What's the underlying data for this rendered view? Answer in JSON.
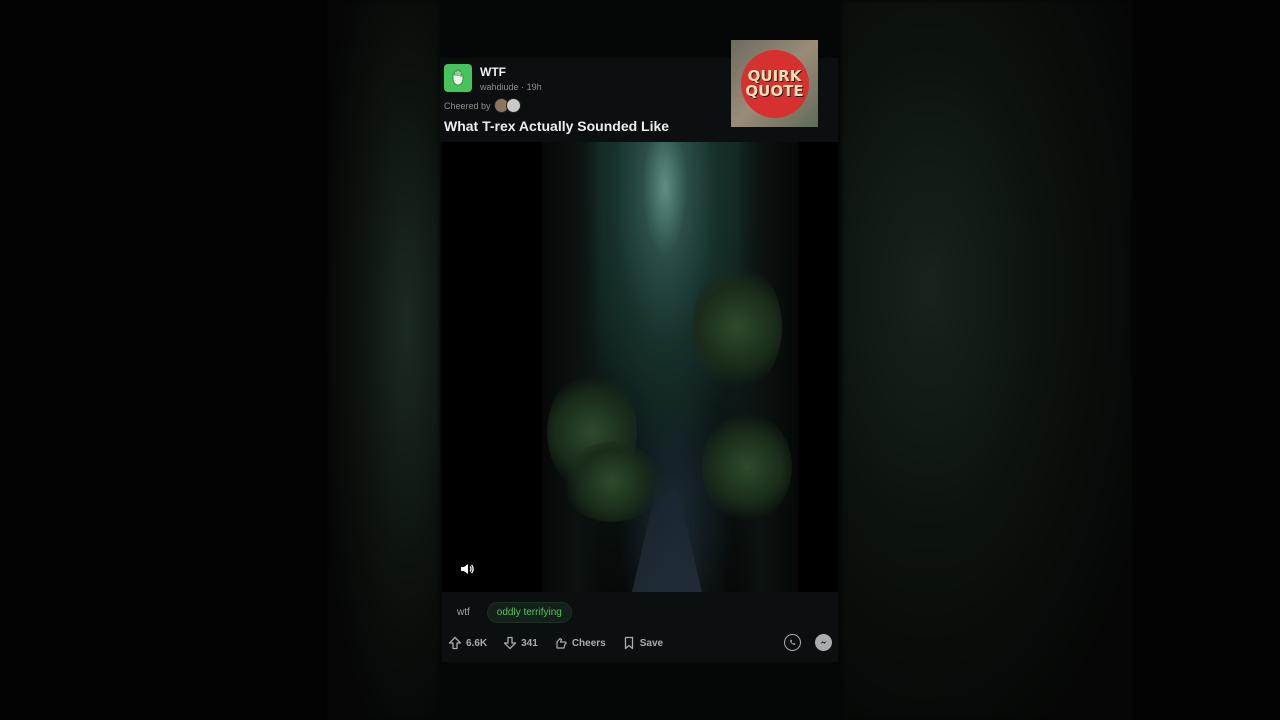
{
  "post": {
    "subreddit": "WTF",
    "author": "wahdiude",
    "separator": "·",
    "age": "19h",
    "cheered_label": "Cheered by",
    "title": "What T-rex Actually Sounded Like"
  },
  "thumbnail": {
    "line1": "QUIRK",
    "line2": "QUOTE"
  },
  "media": {
    "sound_icon": "speaker-icon"
  },
  "tags": {
    "tag1": "wtf",
    "flair": "oddly terrifying"
  },
  "actions": {
    "upvotes": "6.6K",
    "downvotes": "341",
    "cheers": "Cheers",
    "save": "Save"
  },
  "colors": {
    "subreddit_icon": "#46c45c",
    "flair_text": "#58c45e",
    "thumb_badge": "#d7312f"
  }
}
